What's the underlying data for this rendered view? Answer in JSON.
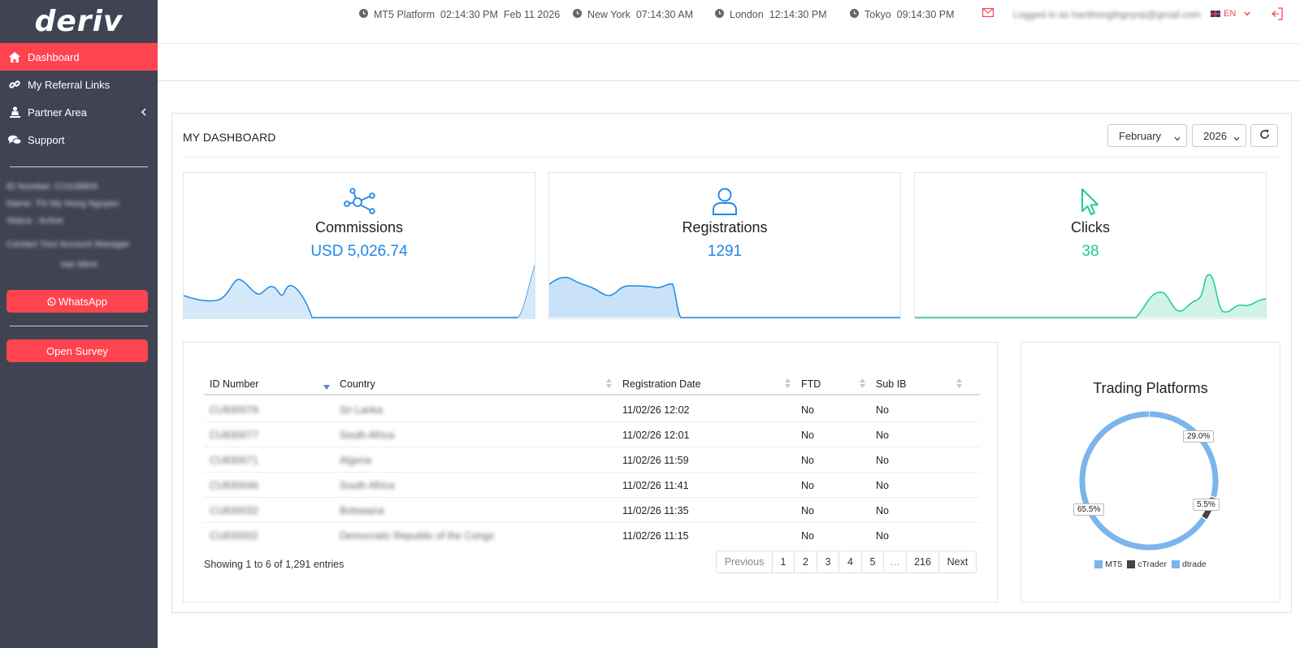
{
  "brand": {
    "logo_text": "deriv"
  },
  "sidebar": {
    "items": [
      {
        "label": "Dashboard",
        "icon": "home-icon",
        "active": true
      },
      {
        "label": "My Referral Links",
        "icon": "link-icon",
        "active": false
      },
      {
        "label": "Partner Area",
        "icon": "person-icon",
        "active": false
      },
      {
        "label": "Support",
        "icon": "chat-icon",
        "active": false
      }
    ],
    "info_lines": [
      "ID Number: CU108809",
      "Name: Thi My Hong Nguyen",
      "Status : Active",
      "Contact Your Account Manager",
      "Van Minh"
    ],
    "whatsapp_label": "WhatsApp",
    "survey_label": "Open Survey"
  },
  "topbar": {
    "clocks": [
      {
        "label": "MT5 Platform",
        "time": "02:14:30 PM",
        "date": "Feb 11 2026"
      },
      {
        "label": "New York",
        "time": "07:14:30 AM"
      },
      {
        "label": "London",
        "time": "12:14:30 PM"
      },
      {
        "label": "Tokyo",
        "time": "09:14:30 PM"
      }
    ],
    "user_text": "Logged in as hanthongthgnyvp@gmail.com",
    "language": "EN"
  },
  "dashboard": {
    "title": "MY DASHBOARD",
    "month": "February",
    "year": "2026"
  },
  "cards": [
    {
      "title": "Commissions",
      "value": "USD 5,026.74",
      "icon": "network-icon",
      "color": "#1e88e5"
    },
    {
      "title": "Registrations",
      "value": "1291",
      "icon": "user-icon",
      "color": "#1e88e5"
    },
    {
      "title": "Clicks",
      "value": "38",
      "icon": "cursor-icon",
      "color": "#20c997"
    }
  ],
  "table": {
    "columns": [
      "ID Number",
      "Country",
      "Registration Date",
      "FTD",
      "Sub IB"
    ],
    "rows": [
      {
        "id": "CU830079",
        "country": "Sri Lanka",
        "date": "11/02/26 12:02",
        "ftd": "No",
        "subib": "No"
      },
      {
        "id": "CU830077",
        "country": "South Africa",
        "date": "11/02/26 12:01",
        "ftd": "No",
        "subib": "No"
      },
      {
        "id": "CU830071",
        "country": "Algeria",
        "date": "11/02/26 11:59",
        "ftd": "No",
        "subib": "No"
      },
      {
        "id": "CU830046",
        "country": "South Africa",
        "date": "11/02/26 11:41",
        "ftd": "No",
        "subib": "No"
      },
      {
        "id": "CU830032",
        "country": "Botswana",
        "date": "11/02/26 11:35",
        "ftd": "No",
        "subib": "No"
      },
      {
        "id": "CU830002",
        "country": "Democratic Republic of the Congo",
        "date": "11/02/26 11:15",
        "ftd": "No",
        "subib": "No"
      }
    ],
    "info": "Showing 1 to 6 of 1,291 entries",
    "pagination": [
      "Previous",
      "1",
      "2",
      "3",
      "4",
      "5",
      "…",
      "216",
      "Next"
    ]
  },
  "chart_data": {
    "type": "pie",
    "title": "Trading Platforms",
    "categories": [
      "MT5",
      "cTrader",
      "dtrade"
    ],
    "values": [
      65.5,
      5.5,
      29.0
    ],
    "labels": [
      "65.5%",
      "5.5%",
      "29.0%"
    ],
    "colors": [
      "#7cb5ec",
      "#434348",
      "#7cb5ec"
    ],
    "legend": "bottom"
  }
}
